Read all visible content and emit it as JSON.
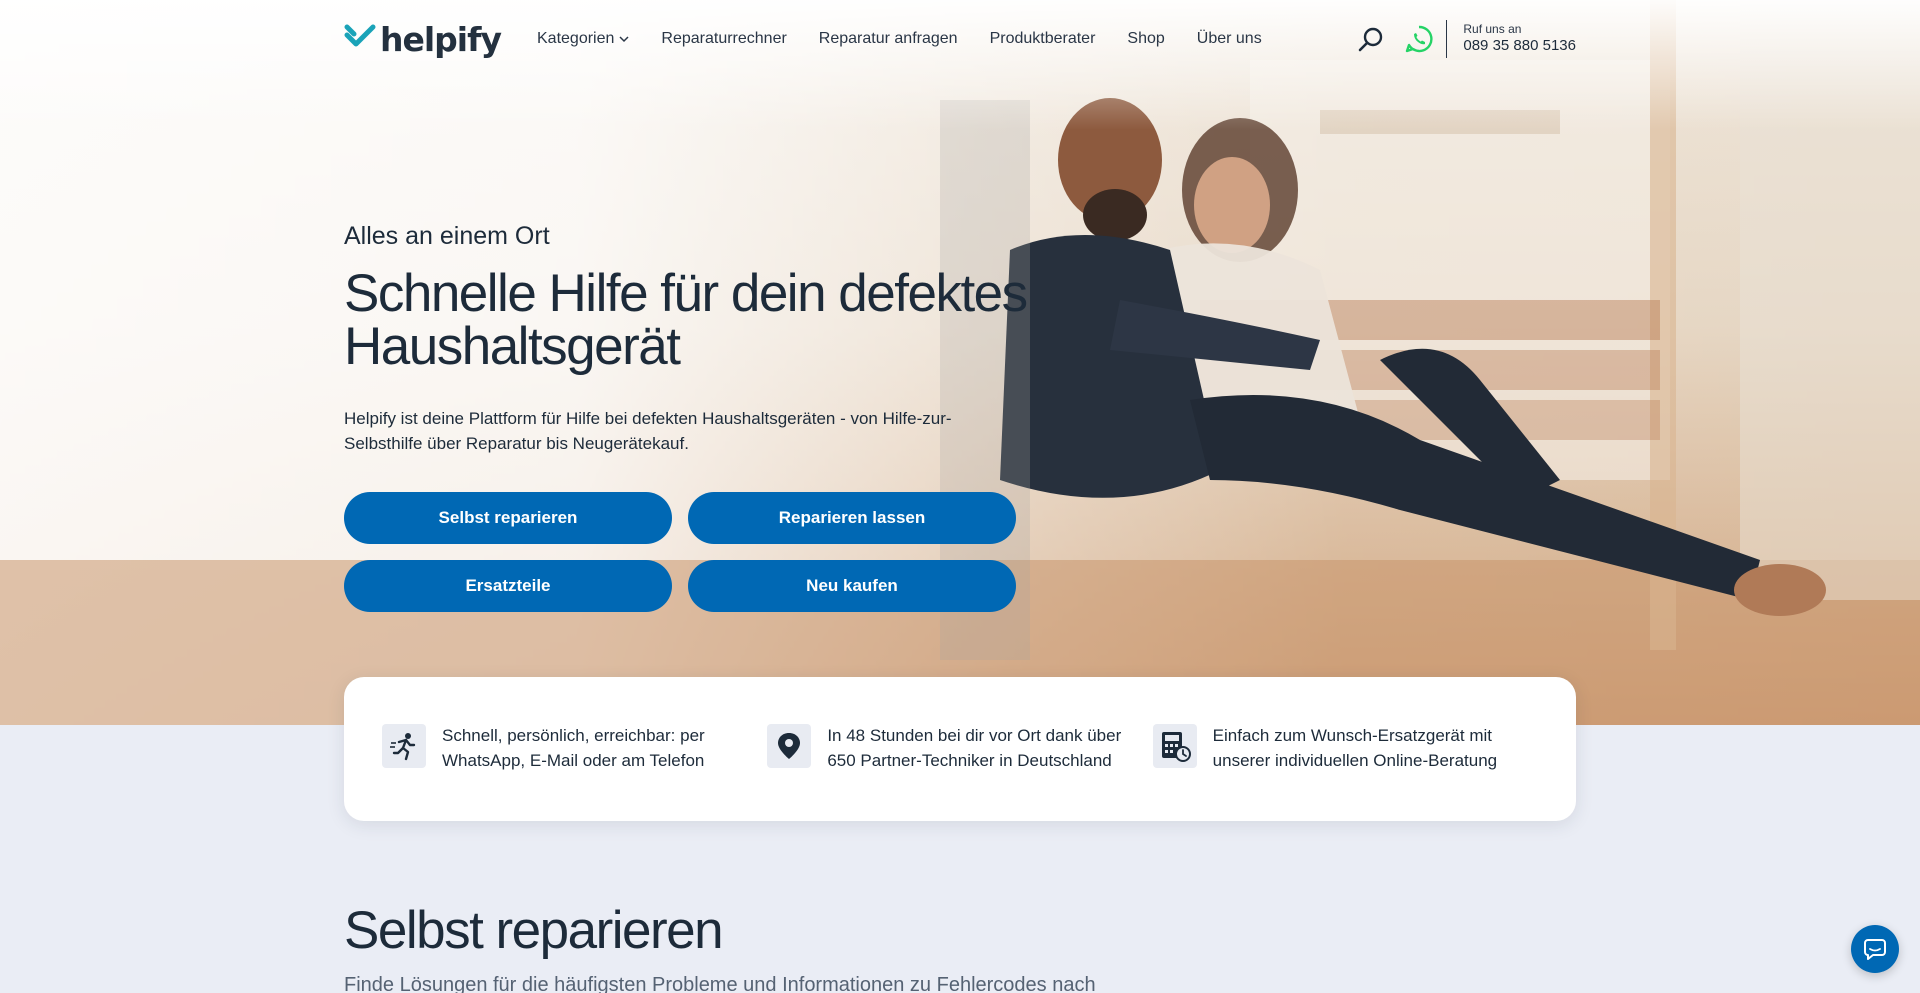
{
  "brand": {
    "name": "helpify",
    "accent": "#0068b4",
    "logo_color": "#1aa3b8"
  },
  "nav": {
    "items": [
      {
        "label": "Kategorien",
        "has_dropdown": true
      },
      {
        "label": "Reparaturrechner"
      },
      {
        "label": "Reparatur anfragen"
      },
      {
        "label": "Produktberater"
      },
      {
        "label": "Shop"
      },
      {
        "label": "Über uns"
      }
    ]
  },
  "header": {
    "icons": [
      "search-icon",
      "whatsapp-icon"
    ],
    "whatsapp_color": "#25d366",
    "call_label": "Ruf uns an",
    "call_number": "089 35 880 5136"
  },
  "hero": {
    "kicker": "Alles an einem Ort",
    "headline_line1": "Schnelle Hilfe für dein defektes",
    "headline_line2": "Haushaltsgerät",
    "intro": "Helpify ist deine Plattform für Hilfe bei defekten Haushaltsgeräten - von Hilfe-zur-Selbsthilfe über Reparatur bis Neugerätekauf.",
    "buttons": [
      {
        "label": "Selbst reparieren"
      },
      {
        "label": "Reparieren lassen"
      },
      {
        "label": "Ersatzteile"
      },
      {
        "label": "Neu kaufen"
      }
    ]
  },
  "features": [
    {
      "icon": "running-person-icon",
      "text": "Schnell, persönlich, erreichbar: per WhatsApp, E-Mail oder am Telefon"
    },
    {
      "icon": "location-pin-icon",
      "text": "In 48 Stunden bei dir vor Ort dank über 650 Partner-Techniker in Deutschland"
    },
    {
      "icon": "calculator-clock-icon",
      "text": "Einfach zum Wunsch-Ersatzgerät mit unserer individuellen Online-Beratung"
    }
  ],
  "section": {
    "title": "Selbst reparieren",
    "subtitle": "Finde Lösungen für die häufigsten Probleme und Informationen zu Fehlercodes nach"
  },
  "chat": {
    "icon": "chat-bubble-icon"
  }
}
